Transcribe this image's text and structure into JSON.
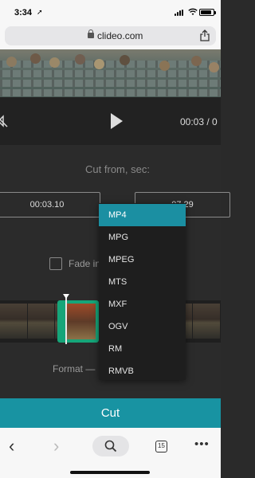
{
  "status_bar": {
    "time": "3:34"
  },
  "browser": {
    "url": "clideo.com",
    "tab_count": "15"
  },
  "player": {
    "current_time": "00:03 / 0"
  },
  "editor": {
    "cut_from_label": "Cut from, sec:",
    "from_value": "00:03.10",
    "to_value": "07.29",
    "fade_in_label": "Fade in",
    "format_label": "Format —"
  },
  "dropdown": {
    "options": [
      "MP4",
      "MPG",
      "MPEG",
      "MTS",
      "MXF",
      "OGV",
      "RM",
      "RMVB"
    ],
    "selected": "MP4"
  },
  "cut_button": {
    "label": "Cut"
  },
  "colors": {
    "accent": "#1893a2",
    "selection": "#16a579"
  }
}
